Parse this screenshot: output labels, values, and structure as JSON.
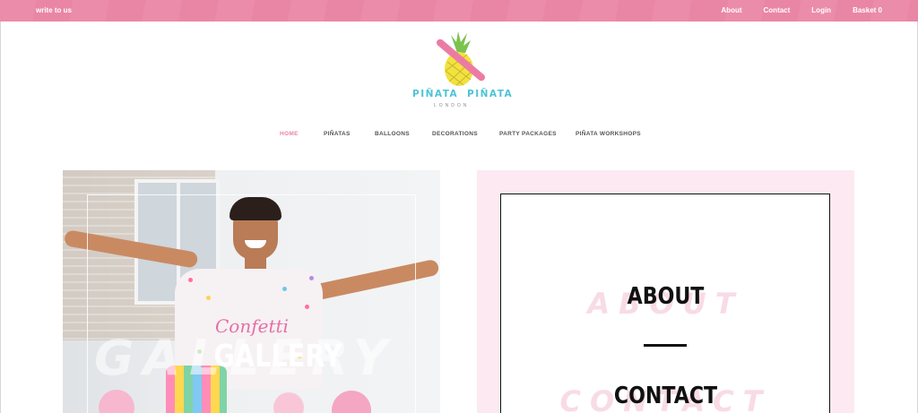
{
  "topbar": {
    "write_to_us": "write to us",
    "about": "About",
    "contact": "Contact",
    "login": "Login",
    "basket": "Basket 0",
    "color": "#ea86a5"
  },
  "logo": {
    "left_word": "PIÑATA",
    "right_word": "PIÑATA",
    "subtitle": "LONDON",
    "icon": "pineapple-icon"
  },
  "nav": {
    "items": [
      {
        "label": "HOME",
        "active": true
      },
      {
        "label": "PIÑATAS",
        "active": false
      },
      {
        "label": "BALLOONS",
        "active": false
      },
      {
        "label": "DECORATIONS",
        "active": false
      },
      {
        "label": "PARTY PACKAGES",
        "active": false
      },
      {
        "label": "PIÑATA WORKSHOPS",
        "active": false
      }
    ],
    "active_color": "#ea86a5"
  },
  "gallery": {
    "label": "GALLERY",
    "ghost_label": "GALLERY",
    "shirt_text": "Confetti"
  },
  "aboutbox": {
    "about": "ABOUT",
    "contact": "CONTACT",
    "ghost_about": "ABOUT",
    "ghost_contact": "CONTACT",
    "background": "#fde9f1"
  }
}
